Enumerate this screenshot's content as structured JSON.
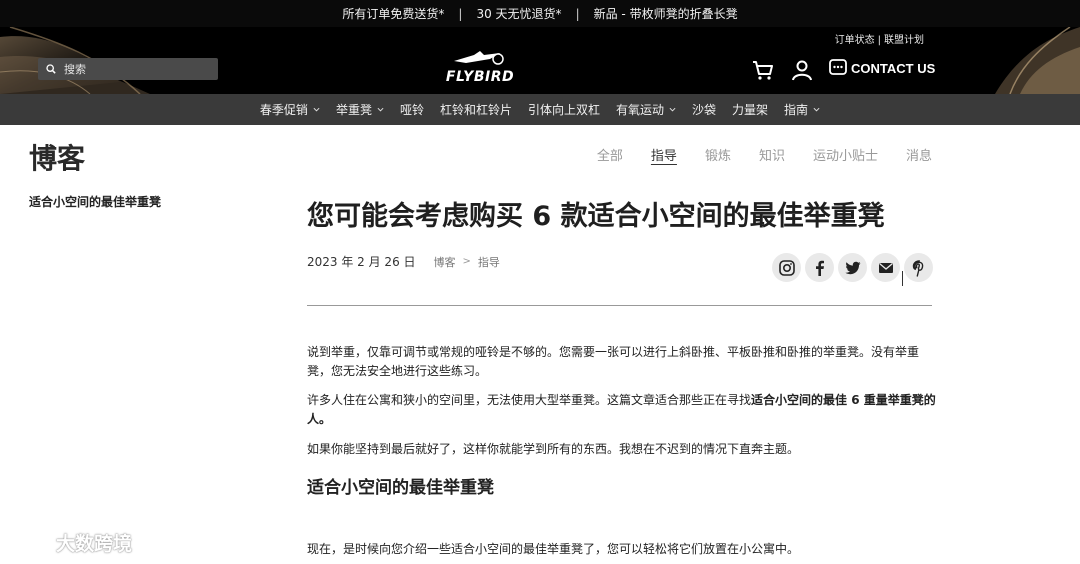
{
  "announcement": {
    "items": [
      "所有订单免费送货*",
      "30 天无忧退货*",
      "新品 - 带枚师凳的折叠长凳"
    ],
    "separator": "|"
  },
  "header": {
    "search_placeholder": "搜索",
    "logo_text": "FLYBIRD",
    "top_links": [
      "订单状态",
      "联盟计划"
    ],
    "top_link_sep": "|",
    "contact_label": "CONTACT US",
    "icons": [
      "search-icon",
      "cart-icon",
      "user-icon",
      "chat-icon"
    ]
  },
  "nav": {
    "items": [
      {
        "label": "春季促销",
        "dropdown": true
      },
      {
        "label": "举重凳",
        "dropdown": true
      },
      {
        "label": "哑铃",
        "dropdown": false
      },
      {
        "label": "杠铃和杠铃片",
        "dropdown": false
      },
      {
        "label": "引体向上双杠",
        "dropdown": false
      },
      {
        "label": "有氧运动",
        "dropdown": true
      },
      {
        "label": "沙袋",
        "dropdown": false
      },
      {
        "label": "力量架",
        "dropdown": false
      },
      {
        "label": "指南",
        "dropdown": true
      }
    ]
  },
  "blog": {
    "title": "博客",
    "categories": [
      "全部",
      "指导",
      "锻炼",
      "知识",
      "运动小贴士",
      "消息"
    ],
    "active_category": "指导",
    "sidebar_link": "适合小空间的最佳举重凳"
  },
  "article": {
    "title": "您可能会考虑购买 6 款适合小空间的最佳举重凳",
    "date": "2023 年 2 月 26 日",
    "breadcrumb": [
      "博客",
      "指导"
    ],
    "breadcrumb_sep": ">",
    "share_icons": [
      "instagram-icon",
      "facebook-icon",
      "twitter-icon",
      "email-icon",
      "pinterest-icon"
    ],
    "p1": "说到举重，仅靠可调节或常规的哑铃是不够的。您需要一张可以进行上斜卧推、平板卧推和卧推的举重凳。没有举重凳，您无法安全地进行这些练习。",
    "p2_before": "许多人住在公寓和狭小的空间里，无法使用大型举重凳。这篇文章适合那些正在寻找",
    "p2_bold": "适合小空间的最佳 6 重量举重凳的人。",
    "p3": "如果你能坚持到最后就好了，这样你就能学到所有的东西。我想在不迟到的情况下直奔主题。",
    "h2": "适合小空间的最佳举重凳",
    "p4": "现在，是时候向您介绍一些适合小空间的最佳举重凳了，您可以轻松将它们放置在小公寓中。"
  },
  "watermark": {
    "text": "大数跨境"
  },
  "colors": {
    "topbar": "#0a0a0a",
    "header": "#000000",
    "nav": "#3a3a3a",
    "share_bg": "#e9e9e9",
    "divider": "#999999"
  }
}
